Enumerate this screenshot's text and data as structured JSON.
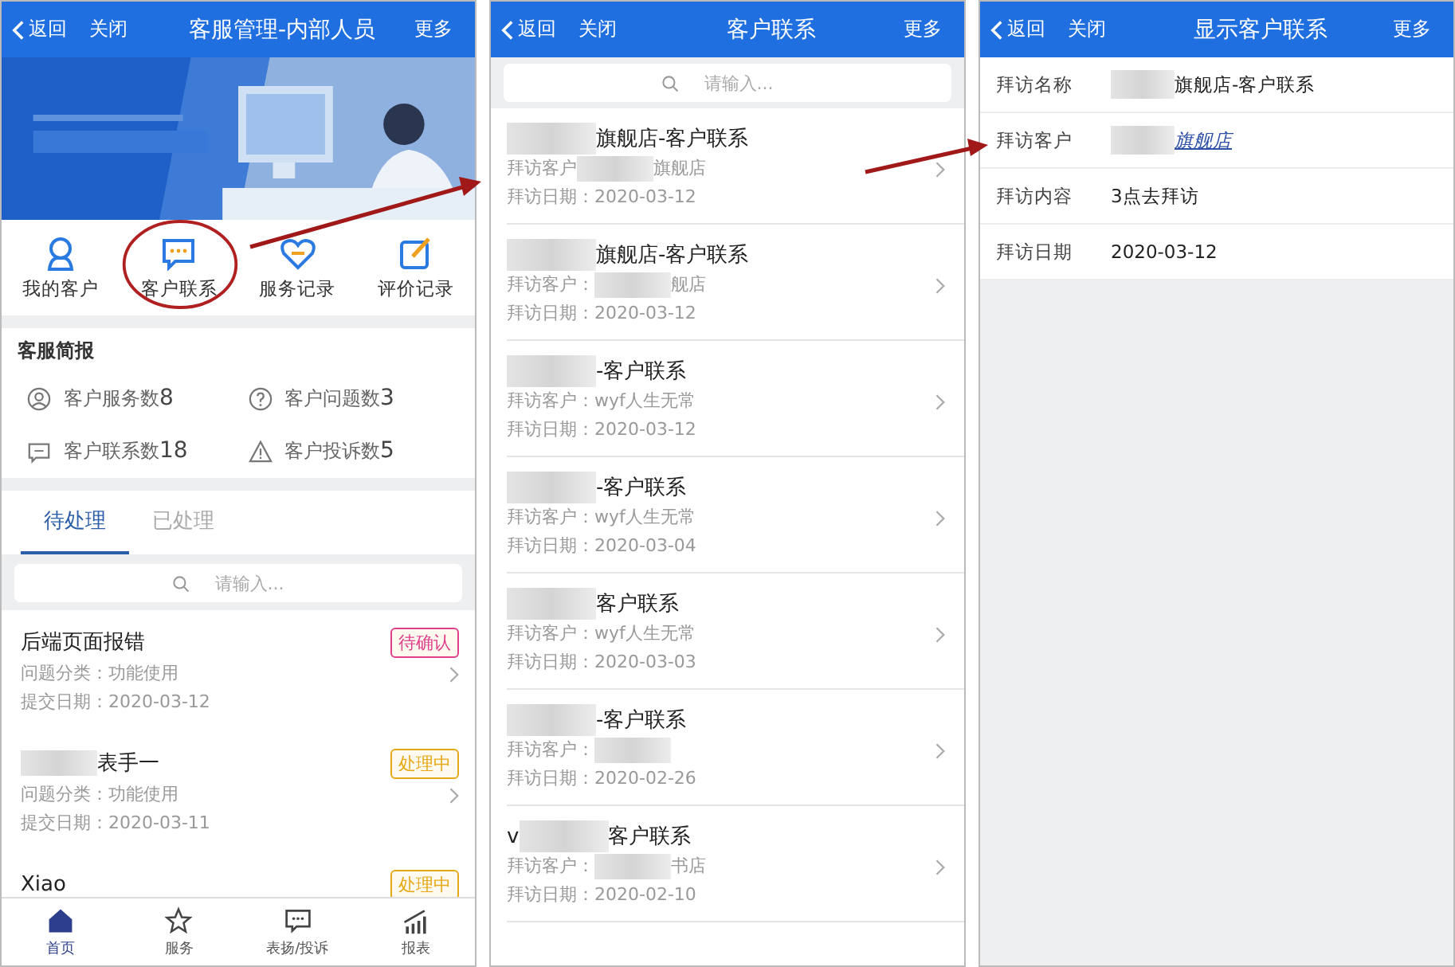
{
  "screens": [
    {
      "header": {
        "back": "返回",
        "close": "关闭",
        "title": "客服管理-内部人员",
        "more": "更多"
      },
      "banner": {
        "kind": "picture"
      },
      "shortcuts": [
        {
          "label": "我的客户"
        },
        {
          "label": "客户联系",
          "highlighted": true
        },
        {
          "label": "服务记录",
          "highlighted": false
        },
        {
          "label": "评价记录",
          "highlighted": false
        }
      ],
      "report": {
        "title": "客服简报",
        "stats": [
          {
            "label": "客户服务数",
            "count": "8"
          },
          {
            "label": "客户问题数",
            "count": "3"
          },
          {
            "label": "客户联系数",
            "count": "18"
          },
          {
            "label": "客户投诉数",
            "count": "5"
          }
        ]
      },
      "tabs": [
        {
          "label": "待处理",
          "selected": true
        },
        {
          "label": "已处理",
          "selected": false
        }
      ],
      "search": {
        "placeholder": "请输入..."
      },
      "issues": [
        {
          "title": "后端页面报错",
          "blurred": false,
          "status": "待确认",
          "color": "#e0408a",
          "category": "问题分类：功能使用",
          "date": "提交日期：2020-03-12"
        },
        {
          "title": "表手一",
          "blurred": true,
          "status": "处理中",
          "color": "#e6a817",
          "category": "问题分类：功能使用",
          "date": "提交日期：2020-03-11"
        },
        {
          "title": "Xiao",
          "blurred": false,
          "status": "处理中",
          "color": "#e6a817"
        }
      ],
      "nav": [
        {
          "label": "首页",
          "selected": true
        },
        {
          "label": "服务",
          "selected": false
        },
        {
          "label": "表扬/投诉",
          "selected": false
        },
        {
          "label": "报表",
          "selected": false
        }
      ]
    },
    {
      "header": {
        "back": "返回",
        "close": "关闭",
        "title": "客户联系",
        "more": "更多"
      },
      "search": {
        "placeholder": "请输入..."
      },
      "contacts": [
        {
          "title": "旗舰店-客户联系",
          "customer_label": "拜访客户",
          "customer": "旗舰店",
          "customer_blurred": true,
          "date": "拜访日期：2020-03-12"
        },
        {
          "title": "旗舰店-客户联系",
          "customer_label": "拜访客户：",
          "customer": "舰店",
          "customer_blurred": true,
          "date": "拜访日期：2020-03-12"
        },
        {
          "title": "-客户联系",
          "customer_label": "拜访客户：",
          "customer": "wyf人生无常",
          "customer_blurred": false,
          "date": "拜访日期：2020-03-12"
        },
        {
          "title": "-客户联系",
          "customer_label": "拜访客户：",
          "customer": "wyf人生无常",
          "customer_blurred": false,
          "date": "拜访日期：2020-03-04"
        },
        {
          "title": "客户联系",
          "customer_label": "拜访客户：",
          "customer": "wyf人生无常",
          "customer_blurred": false,
          "date": "拜访日期：2020-03-03"
        },
        {
          "title": "-客户联系",
          "customer_label": "拜访客户：",
          "customer_blurred": true,
          "date": "拜访日期：2020-02-26"
        },
        {
          "lead": "v",
          "title": "客户联系",
          "customer_label": "拜访客户：",
          "customer": "书店",
          "customer_blurred": true,
          "date": "拜访日期：2020-02-10"
        }
      ]
    },
    {
      "header": {
        "back": "返回",
        "close": "关闭",
        "title": "显示客户联系",
        "more": "更多"
      },
      "fields": [
        {
          "label": "拜访名称",
          "value": "旗舰店-客户联系",
          "blurred": true,
          "kind": "text"
        },
        {
          "label": "拜访客户",
          "value": "旗舰店",
          "blurred": true,
          "kind": "link"
        },
        {
          "label": "拜访内容",
          "value": "3点去拜访",
          "blurred": false,
          "kind": "text"
        },
        {
          "label": "拜访日期",
          "value": "2020-03-12",
          "blurred": false,
          "kind": "text"
        }
      ]
    }
  ]
}
